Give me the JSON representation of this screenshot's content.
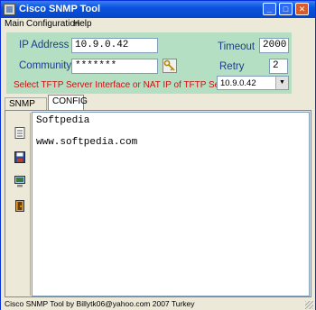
{
  "window": {
    "title": "Cisco SNMP Tool"
  },
  "menu": [
    "Main",
    "Configuration",
    "Help"
  ],
  "form": {
    "ip_label": "IP Address",
    "ip_value": "10.9.0.42",
    "community_label": "Community",
    "community_value": "*******",
    "timeout_label": "Timeout",
    "timeout_value": "2000",
    "retry_label": "Retry",
    "retry_value": "2",
    "tftp_note": "Select TFTP Server Interface or NAT IP of TFTP Server",
    "tftp_select_value": "10.9.0.42"
  },
  "tabs": [
    "SNMP LOG",
    "CONFIG"
  ],
  "editor_text": "Softpedia\n\nwww.softpedia.com",
  "toolbar_icons": [
    "open-file-icon",
    "save-config-icon",
    "send-to-device-icon",
    "exit-icon"
  ],
  "status": "Cisco SNMP Tool  by  Billytk06@yahoo.com 2007 Turkey",
  "colors": {
    "panel": "#b5dfc2",
    "label_blue": "#1b3d8c",
    "warning_red": "#cc1111",
    "titlebar": "#0a52dd"
  }
}
